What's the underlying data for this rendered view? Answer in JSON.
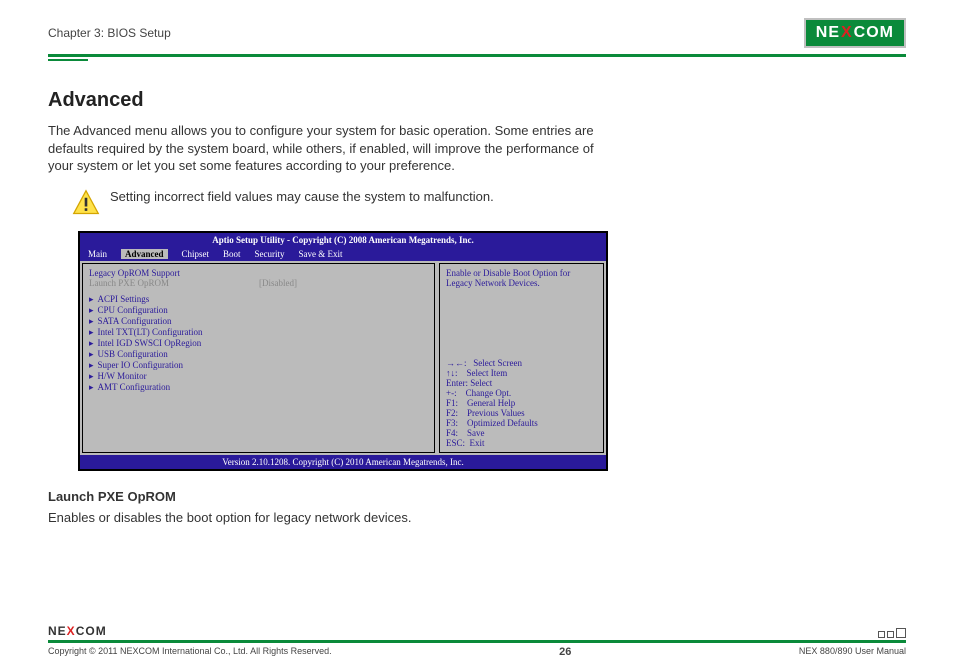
{
  "header": {
    "chapter": "Chapter 3: BIOS Setup",
    "logo_left": "NE",
    "logo_x": "X",
    "logo_right": "COM"
  },
  "main": {
    "title": "Advanced",
    "intro": "The Advanced menu allows you to configure your system for basic operation. Some entries are defaults required by the system board, while others, if enabled, will improve the performance of your system or let you set some features according to your preference.",
    "warning": "Setting incorrect field values may cause the system to malfunction."
  },
  "bios": {
    "title": "Aptio Setup Utility - Copyright (C) 2008 American Megatrends, Inc.",
    "tabs": [
      "Main",
      "Advanced",
      "Chipset",
      "Boot",
      "Security",
      "Save & Exit"
    ],
    "selected_tab": "Advanced",
    "group": "Legacy OpROM Support",
    "item_label": "Launch PXE OpROM",
    "item_value": "[Disabled]",
    "submenus": [
      "ACPI Settings",
      "CPU Configuration",
      "SATA Configuration",
      "Intel TXT(LT) Configuration",
      "Intel IGD SWSCI OpRegion",
      "USB Configuration",
      "Super IO Configuration",
      "H/W Monitor",
      "AMT Configuration"
    ],
    "help": "Enable or Disable Boot Option for Legacy Network Devices.",
    "keys": [
      "→←:   Select Screen",
      "↑↓:    Select Item",
      "Enter: Select",
      "+-:    Change Opt.",
      "F1:    General Help",
      "F2:    Previous Values",
      "F3:    Optimized Defaults",
      "F4:    Save",
      "ESC:  Exit"
    ],
    "bottom": "Version 2.10.1208. Copyright (C) 2010 American Megatrends, Inc."
  },
  "section": {
    "heading": "Launch PXE OpROM",
    "body": "Enables or disables the boot option for legacy network devices."
  },
  "footer": {
    "logo_left": "NE",
    "logo_x": "X",
    "logo_right": "COM",
    "copyright": "Copyright © 2011 NEXCOM International Co., Ltd. All Rights Reserved.",
    "page": "26",
    "doc": "NEX 880/890 User Manual"
  }
}
